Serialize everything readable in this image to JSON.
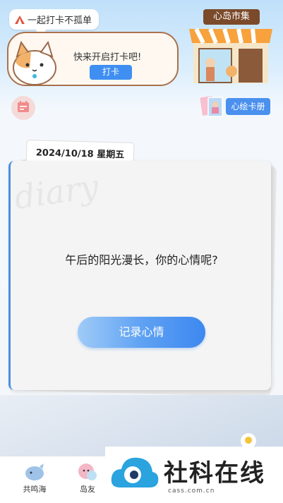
{
  "header": {
    "bubble_text": "一起打卡不孤单",
    "checkin_prompt": "快来开启打卡吧!",
    "checkin_button": "打卡",
    "shop_sign": "心岛市集"
  },
  "toolbar": {
    "cards_label": "心绘卡册"
  },
  "diary": {
    "date": "2024/10/18 星期五",
    "watermark": "diary",
    "question": "午后的阳光漫长，你的心情呢?",
    "record_button": "记录心情"
  },
  "bottom_nav": {
    "items": [
      {
        "label": "共鸣海",
        "icon": "whale-icon"
      },
      {
        "label": "岛友",
        "icon": "friends-icon"
      }
    ]
  },
  "overlay": {
    "brand": "社科在线",
    "url": "cass.com.cn"
  },
  "colors": {
    "accent": "#3f8ff2",
    "card_border": "#a9714e"
  }
}
